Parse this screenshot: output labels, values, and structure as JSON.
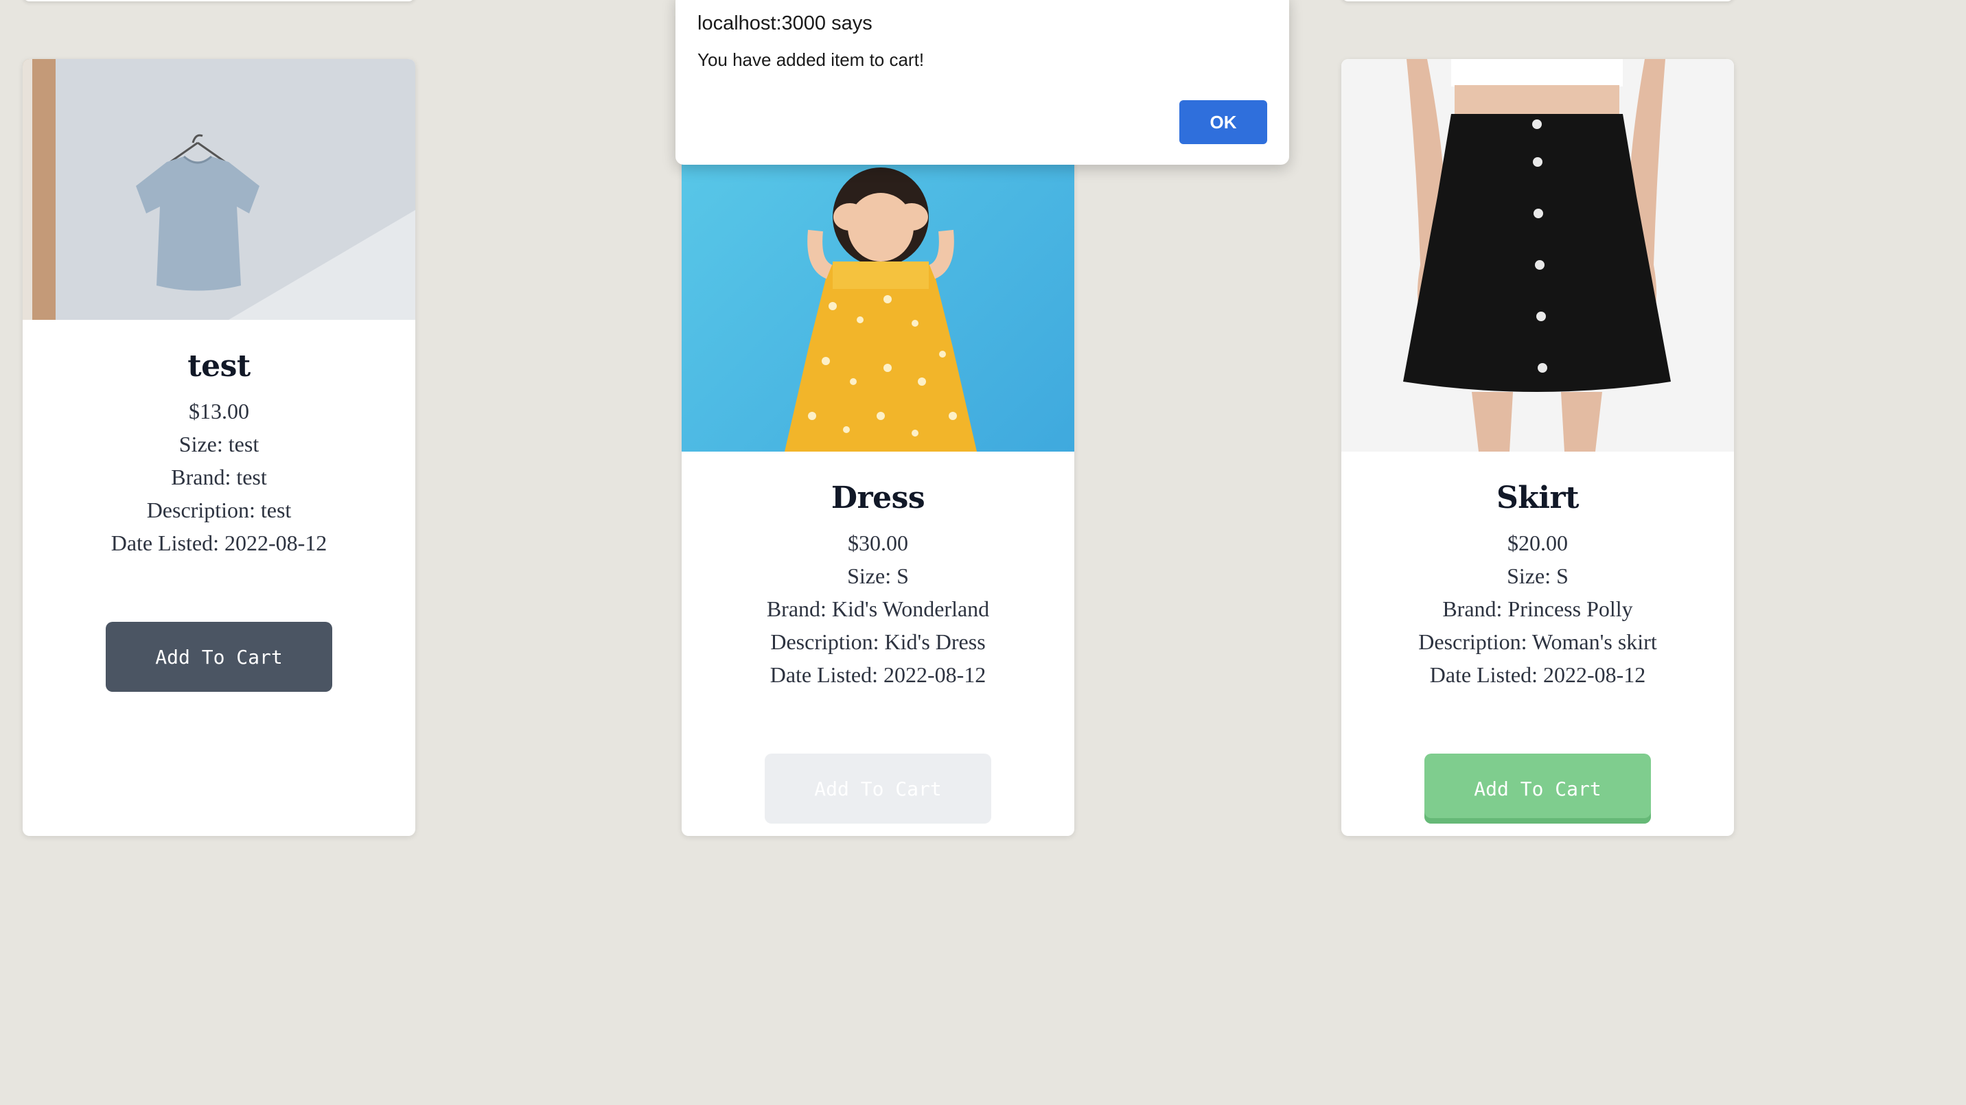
{
  "dialog": {
    "title": "localhost:3000 says",
    "message": "You have added item to cart!",
    "ok_label": "OK"
  },
  "products": [
    {
      "name": "test",
      "price": "$13.00",
      "size": "Size: test",
      "brand": "Brand: test",
      "description": "Description: test",
      "date_listed": "Date Listed: 2022-08-12",
      "button_label": "Add To Cart",
      "button_state": "default"
    },
    {
      "name": "Dress",
      "price": "$30.00",
      "size": "Size: S",
      "brand": "Brand: Kid's Wonderland",
      "description": "Description: Kid's Dress",
      "date_listed": "Date Listed: 2022-08-12",
      "button_label": "Add To Cart",
      "button_state": "disabled"
    },
    {
      "name": "Skirt",
      "price": "$20.00",
      "size": "Size: S",
      "brand": "Brand: Princess Polly",
      "description": "Description: Woman's skirt",
      "date_listed": "Date Listed: 2022-08-12",
      "button_label": "Add To Cart",
      "button_state": "hover"
    }
  ],
  "colors": {
    "page_background": "#e7e5df",
    "dialog_ok": "#2f6fdc",
    "button_dark": "#4b5563",
    "button_green": "#7fcd8e"
  }
}
